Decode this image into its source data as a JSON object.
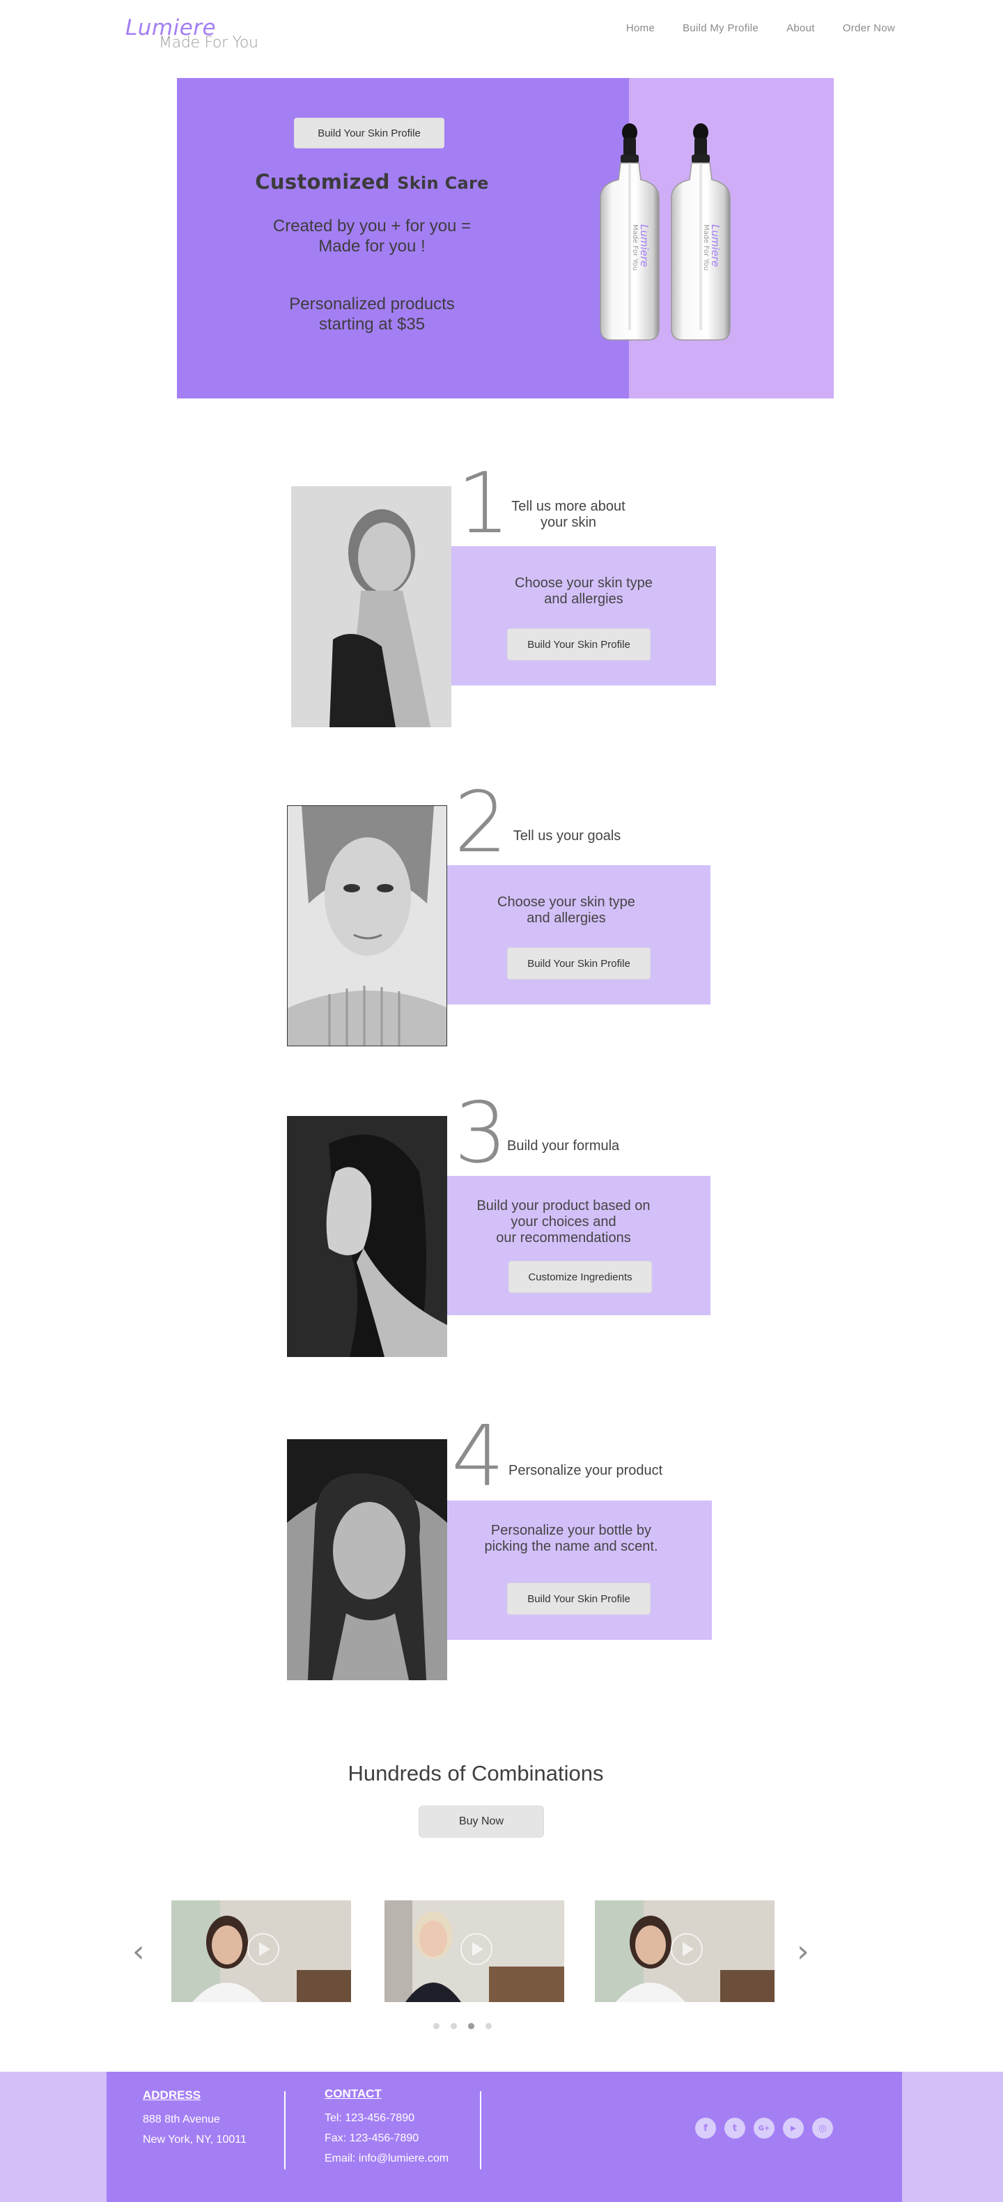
{
  "header": {
    "logo_main": "Lumiere",
    "logo_sub": "Made For You",
    "nav": [
      "Home",
      "Build My Profile",
      "About",
      "Order Now"
    ]
  },
  "hero": {
    "button_label": "Build Your Skin Profile",
    "title_main": "Customized",
    "title_small": "Skin Care",
    "subtitle_line1": "Created by you + for you =",
    "subtitle_line2": "Made for you !",
    "offer_line1": "Personalized products",
    "offer_line2": "starting at $35",
    "bottle_label_main": "Lumiere",
    "bottle_label_sub": "Made For You",
    "colors": {
      "primary": "#a47ff4",
      "light": "#cfadf7",
      "panel": "#d3c0f9"
    }
  },
  "steps": [
    {
      "number": "1",
      "heading_line1": "Tell us more about",
      "heading_line2": "your skin",
      "text_line1": "Choose your skin type",
      "text_line2": "and allergies",
      "text_line3": "",
      "button_label": "Build Your Skin Profile",
      "photo": "portrait-photo"
    },
    {
      "number": "2",
      "heading_line1": "Tell us your goals",
      "heading_line2": "",
      "text_line1": "Choose your skin type",
      "text_line2": "and allergies",
      "text_line3": "",
      "button_label": "Build Your Skin Profile",
      "photo": "portrait-photo"
    },
    {
      "number": "3",
      "heading_line1": "Build your formula",
      "heading_line2": "",
      "text_line1": "Build your product based on",
      "text_line2": "your choices and",
      "text_line3": "our recommendations",
      "button_label": "Customize Ingredients",
      "photo": "profile-photo"
    },
    {
      "number": "4",
      "heading_line1": "Personalize your product",
      "heading_line2": "",
      "text_line1": "Personalize your bottle by",
      "text_line2": "picking the name and scent.",
      "text_line3": "",
      "button_label": "Build Your Skin Profile",
      "photo": "portrait-photo"
    }
  ],
  "combinations": {
    "title": "Hundreds of Combinations",
    "button_label": "Buy Now",
    "prev_icon": "chevron-left-icon",
    "next_icon": "chevron-right-icon",
    "videos": [
      "video-thumbnail",
      "video-thumbnail",
      "video-thumbnail"
    ],
    "dots_count": 4,
    "active_dot": 3
  },
  "footer": {
    "address_heading": "ADDRESS",
    "address_line1": "888 8th Avenue",
    "address_line2": "New York, NY, 10011",
    "contact_heading": "CONTACT",
    "tel": "Tel: 123-456-7890",
    "fax": "Fax: 123-456-7890",
    "email": "Email: info@lumiere.com",
    "social": [
      {
        "icon": "facebook-icon",
        "glyph": "f"
      },
      {
        "icon": "twitter-icon",
        "glyph": "t"
      },
      {
        "icon": "google-plus-icon",
        "glyph": "G+"
      },
      {
        "icon": "youtube-icon",
        "glyph": "▶"
      },
      {
        "icon": "instagram-icon",
        "glyph": "◎"
      }
    ]
  }
}
